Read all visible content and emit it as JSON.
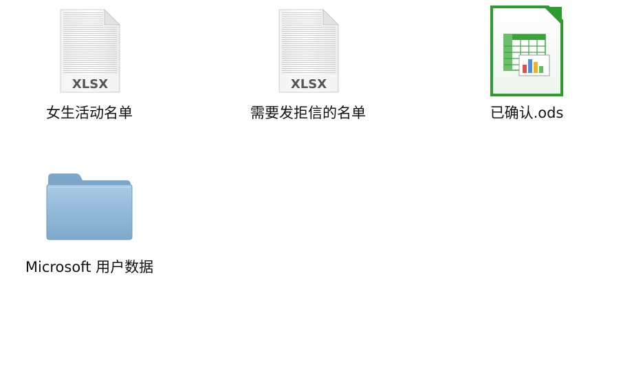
{
  "desktop": {
    "items": [
      {
        "name": "女生活动名单",
        "icon": "xlsx-document-icon",
        "badge": "XLSX"
      },
      {
        "name": "需要发拒信的名单",
        "icon": "xlsx-document-icon",
        "badge": "XLSX"
      },
      {
        "name": "已确认.ods",
        "icon": "ods-spreadsheet-icon"
      },
      {
        "name": "Microsoft 用户数据",
        "icon": "folder-icon"
      }
    ]
  },
  "colors": {
    "folder_blue": "#8fb8d8",
    "ods_green": "#2e9b2e",
    "label_text": "#111111"
  }
}
